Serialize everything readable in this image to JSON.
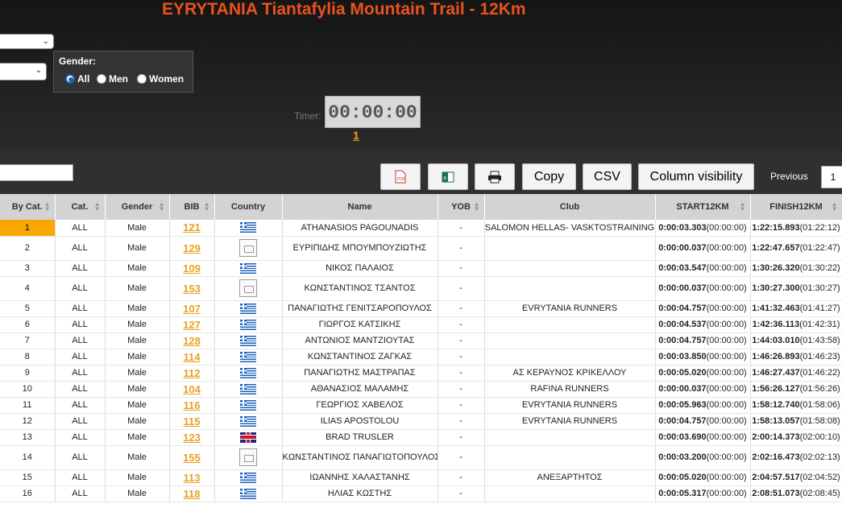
{
  "title": "EYRYTANIA Tiantafylia Mountain Trail - 12Km",
  "gender": {
    "label": "Gender:",
    "options": [
      {
        "label": "All",
        "selected": true
      },
      {
        "label": "Men",
        "selected": false
      },
      {
        "label": "Women",
        "selected": false
      }
    ]
  },
  "timer": {
    "label": "Timer:",
    "value": "00:00:00",
    "link": "1"
  },
  "toolbar": {
    "copy": "Copy",
    "csv": "CSV",
    "colvis": "Column visibility",
    "previous": "Previous",
    "page": "1"
  },
  "columns": [
    "By Cat.",
    "Cat.",
    "Gender",
    "BIB",
    "Country",
    "Name",
    "YOB",
    "Club",
    "START12KM",
    "FINISH12KM"
  ],
  "rows": [
    {
      "rank": "1",
      "cat": "ALL",
      "gender": "Male",
      "bib": "121",
      "flag": "gr",
      "name": "ATHANASIOS PAGOUNADIS",
      "yob": "-",
      "club": "SALOMON HELLAS- VASKTOSTRAINING",
      "start_b": "0:00:03.303",
      "start_s": "(00:00:00)",
      "fin_b": "1:22:15.893",
      "fin_s": "(01:22:12)"
    },
    {
      "rank": "2",
      "cat": "ALL",
      "gender": "Male",
      "bib": "129",
      "flag": "none",
      "name": "ΕΥΡΙΠΙΔΗΣ ΜΠΟΥΜΠΟΥΖΙΩΤΗΣ",
      "yob": "-",
      "club": "",
      "start_b": "0:00:00.037",
      "start_s": "(00:00:00)",
      "fin_b": "1:22:47.657",
      "fin_s": "(01:22:47)"
    },
    {
      "rank": "3",
      "cat": "ALL",
      "gender": "Male",
      "bib": "109",
      "flag": "gr",
      "name": "ΝΙΚΟΣ ΠΑΛΑΙΟΣ",
      "yob": "-",
      "club": "",
      "start_b": "0:00:03.547",
      "start_s": "(00:00:00)",
      "fin_b": "1:30:26.320",
      "fin_s": "(01:30:22)"
    },
    {
      "rank": "4",
      "cat": "ALL",
      "gender": "Male",
      "bib": "153",
      "flag": "none",
      "name": "ΚΩΝΣΤΑΝΤΙΝΟΣ ΤΣΑΝΤΟΣ",
      "yob": "-",
      "club": "",
      "start_b": "0:00:00.037",
      "start_s": "(00:00:00)",
      "fin_b": "1:30:27.300",
      "fin_s": "(01:30:27)"
    },
    {
      "rank": "5",
      "cat": "ALL",
      "gender": "Male",
      "bib": "107",
      "flag": "gr",
      "name": "ΠΑΝΑΓΙΩΤΗΣ ΓΕΝΙΤΣΑΡΟΠΟΥΛΟΣ",
      "yob": "-",
      "club": "EVRYTANIA RUNNERS",
      "start_b": "0:00:04.757",
      "start_s": "(00:00:00)",
      "fin_b": "1:41:32.463",
      "fin_s": "(01:41:27)"
    },
    {
      "rank": "6",
      "cat": "ALL",
      "gender": "Male",
      "bib": "127",
      "flag": "gr",
      "name": "ΓΙΩΡΓΟΣ ΚΑΤΣΙΚΗΣ",
      "yob": "-",
      "club": "",
      "start_b": "0:00:04.537",
      "start_s": "(00:00:00)",
      "fin_b": "1:42:36.113",
      "fin_s": "(01:42:31)"
    },
    {
      "rank": "7",
      "cat": "ALL",
      "gender": "Male",
      "bib": "128",
      "flag": "gr",
      "name": "ΑΝΤΩΝΙΟΣ ΜΑΝΤΖΙΟΥΤΑΣ",
      "yob": "-",
      "club": "",
      "start_b": "0:00:04.757",
      "start_s": "(00:00:00)",
      "fin_b": "1:44:03.010",
      "fin_s": "(01:43:58)"
    },
    {
      "rank": "8",
      "cat": "ALL",
      "gender": "Male",
      "bib": "114",
      "flag": "gr",
      "name": "ΚΩΝΣΤΑΝΤΙΝΟΣ ΖΑΓΚΑΣ",
      "yob": "-",
      "club": "",
      "start_b": "0:00:03.850",
      "start_s": "(00:00:00)",
      "fin_b": "1:46:26.893",
      "fin_s": "(01:46:23)"
    },
    {
      "rank": "9",
      "cat": "ALL",
      "gender": "Male",
      "bib": "112",
      "flag": "gr",
      "name": "ΠΑΝΑΓΙΩΤΗΣ ΜΑΣΤΡΑΠΑΣ",
      "yob": "-",
      "club": "ΑΣ ΚΕΡΑΥΝΟΣ ΚΡΙΚΕΛΛΟΥ",
      "start_b": "0:00:05.020",
      "start_s": "(00:00:00)",
      "fin_b": "1:46:27.437",
      "fin_s": "(01:46:22)"
    },
    {
      "rank": "10",
      "cat": "ALL",
      "gender": "Male",
      "bib": "104",
      "flag": "gr",
      "name": "ΑΘΑΝΑΣΙΟΣ ΜΑΛΑΜΗΣ",
      "yob": "-",
      "club": "RAFINA RUNNERS",
      "start_b": "0:00:00.037",
      "start_s": "(00:00:00)",
      "fin_b": "1:56:26.127",
      "fin_s": "(01:56:26)"
    },
    {
      "rank": "11",
      "cat": "ALL",
      "gender": "Male",
      "bib": "116",
      "flag": "gr",
      "name": "ΓΕΩΡΓΙΟΣ ΧΑΒΕΛΟΣ",
      "yob": "-",
      "club": "EVRYTANIA RUNNERS",
      "start_b": "0:00:05.963",
      "start_s": "(00:00:00)",
      "fin_b": "1:58:12.740",
      "fin_s": "(01:58:06)"
    },
    {
      "rank": "12",
      "cat": "ALL",
      "gender": "Male",
      "bib": "115",
      "flag": "gr",
      "name": "ILIAS APOSTOLOU",
      "yob": "-",
      "club": "EVRYTANIA RUNNERS",
      "start_b": "0:00:04.757",
      "start_s": "(00:00:00)",
      "fin_b": "1:58:13.057",
      "fin_s": "(01:58:08)"
    },
    {
      "rank": "13",
      "cat": "ALL",
      "gender": "Male",
      "bib": "123",
      "flag": "gb",
      "name": "BRAD TRUSLER",
      "yob": "-",
      "club": "",
      "start_b": "0:00:03.690",
      "start_s": "(00:00:00)",
      "fin_b": "2:00:14.373",
      "fin_s": "(02:00:10)"
    },
    {
      "rank": "14",
      "cat": "ALL",
      "gender": "Male",
      "bib": "155",
      "flag": "none",
      "name": "ΚΩΝΣΤΑΝΤΙΝΟΣ ΠΑΝΑΓΙΩΤΟΠΟΥΛΟΣ",
      "yob": "-",
      "club": "",
      "start_b": "0:00:03.200",
      "start_s": "(00:00:00)",
      "fin_b": "2:02:16.473",
      "fin_s": "(02:02:13)"
    },
    {
      "rank": "15",
      "cat": "ALL",
      "gender": "Male",
      "bib": "113",
      "flag": "gr",
      "name": "ΙΩΑΝΝΗΣ ΧΑΛΑΣΤΑΝΗΣ",
      "yob": "-",
      "club": "ΑΝΕΞΑΡΤΗΤΟΣ",
      "start_b": "0:00:05.020",
      "start_s": "(00:00:00)",
      "fin_b": "2:04:57.517",
      "fin_s": "(02:04:52)"
    },
    {
      "rank": "16",
      "cat": "ALL",
      "gender": "Male",
      "bib": "118",
      "flag": "gr",
      "name": "ΗΛΙΑΣ ΚΩΣΤΗΣ",
      "yob": "-",
      "club": "",
      "start_b": "0:00:05.317",
      "start_s": "(00:00:00)",
      "fin_b": "2:08:51.073",
      "fin_s": "(02:08:45)"
    }
  ],
  "colors": {
    "title": "#e8531d",
    "bib": "#e8a020",
    "highlight": "#f8a800"
  }
}
